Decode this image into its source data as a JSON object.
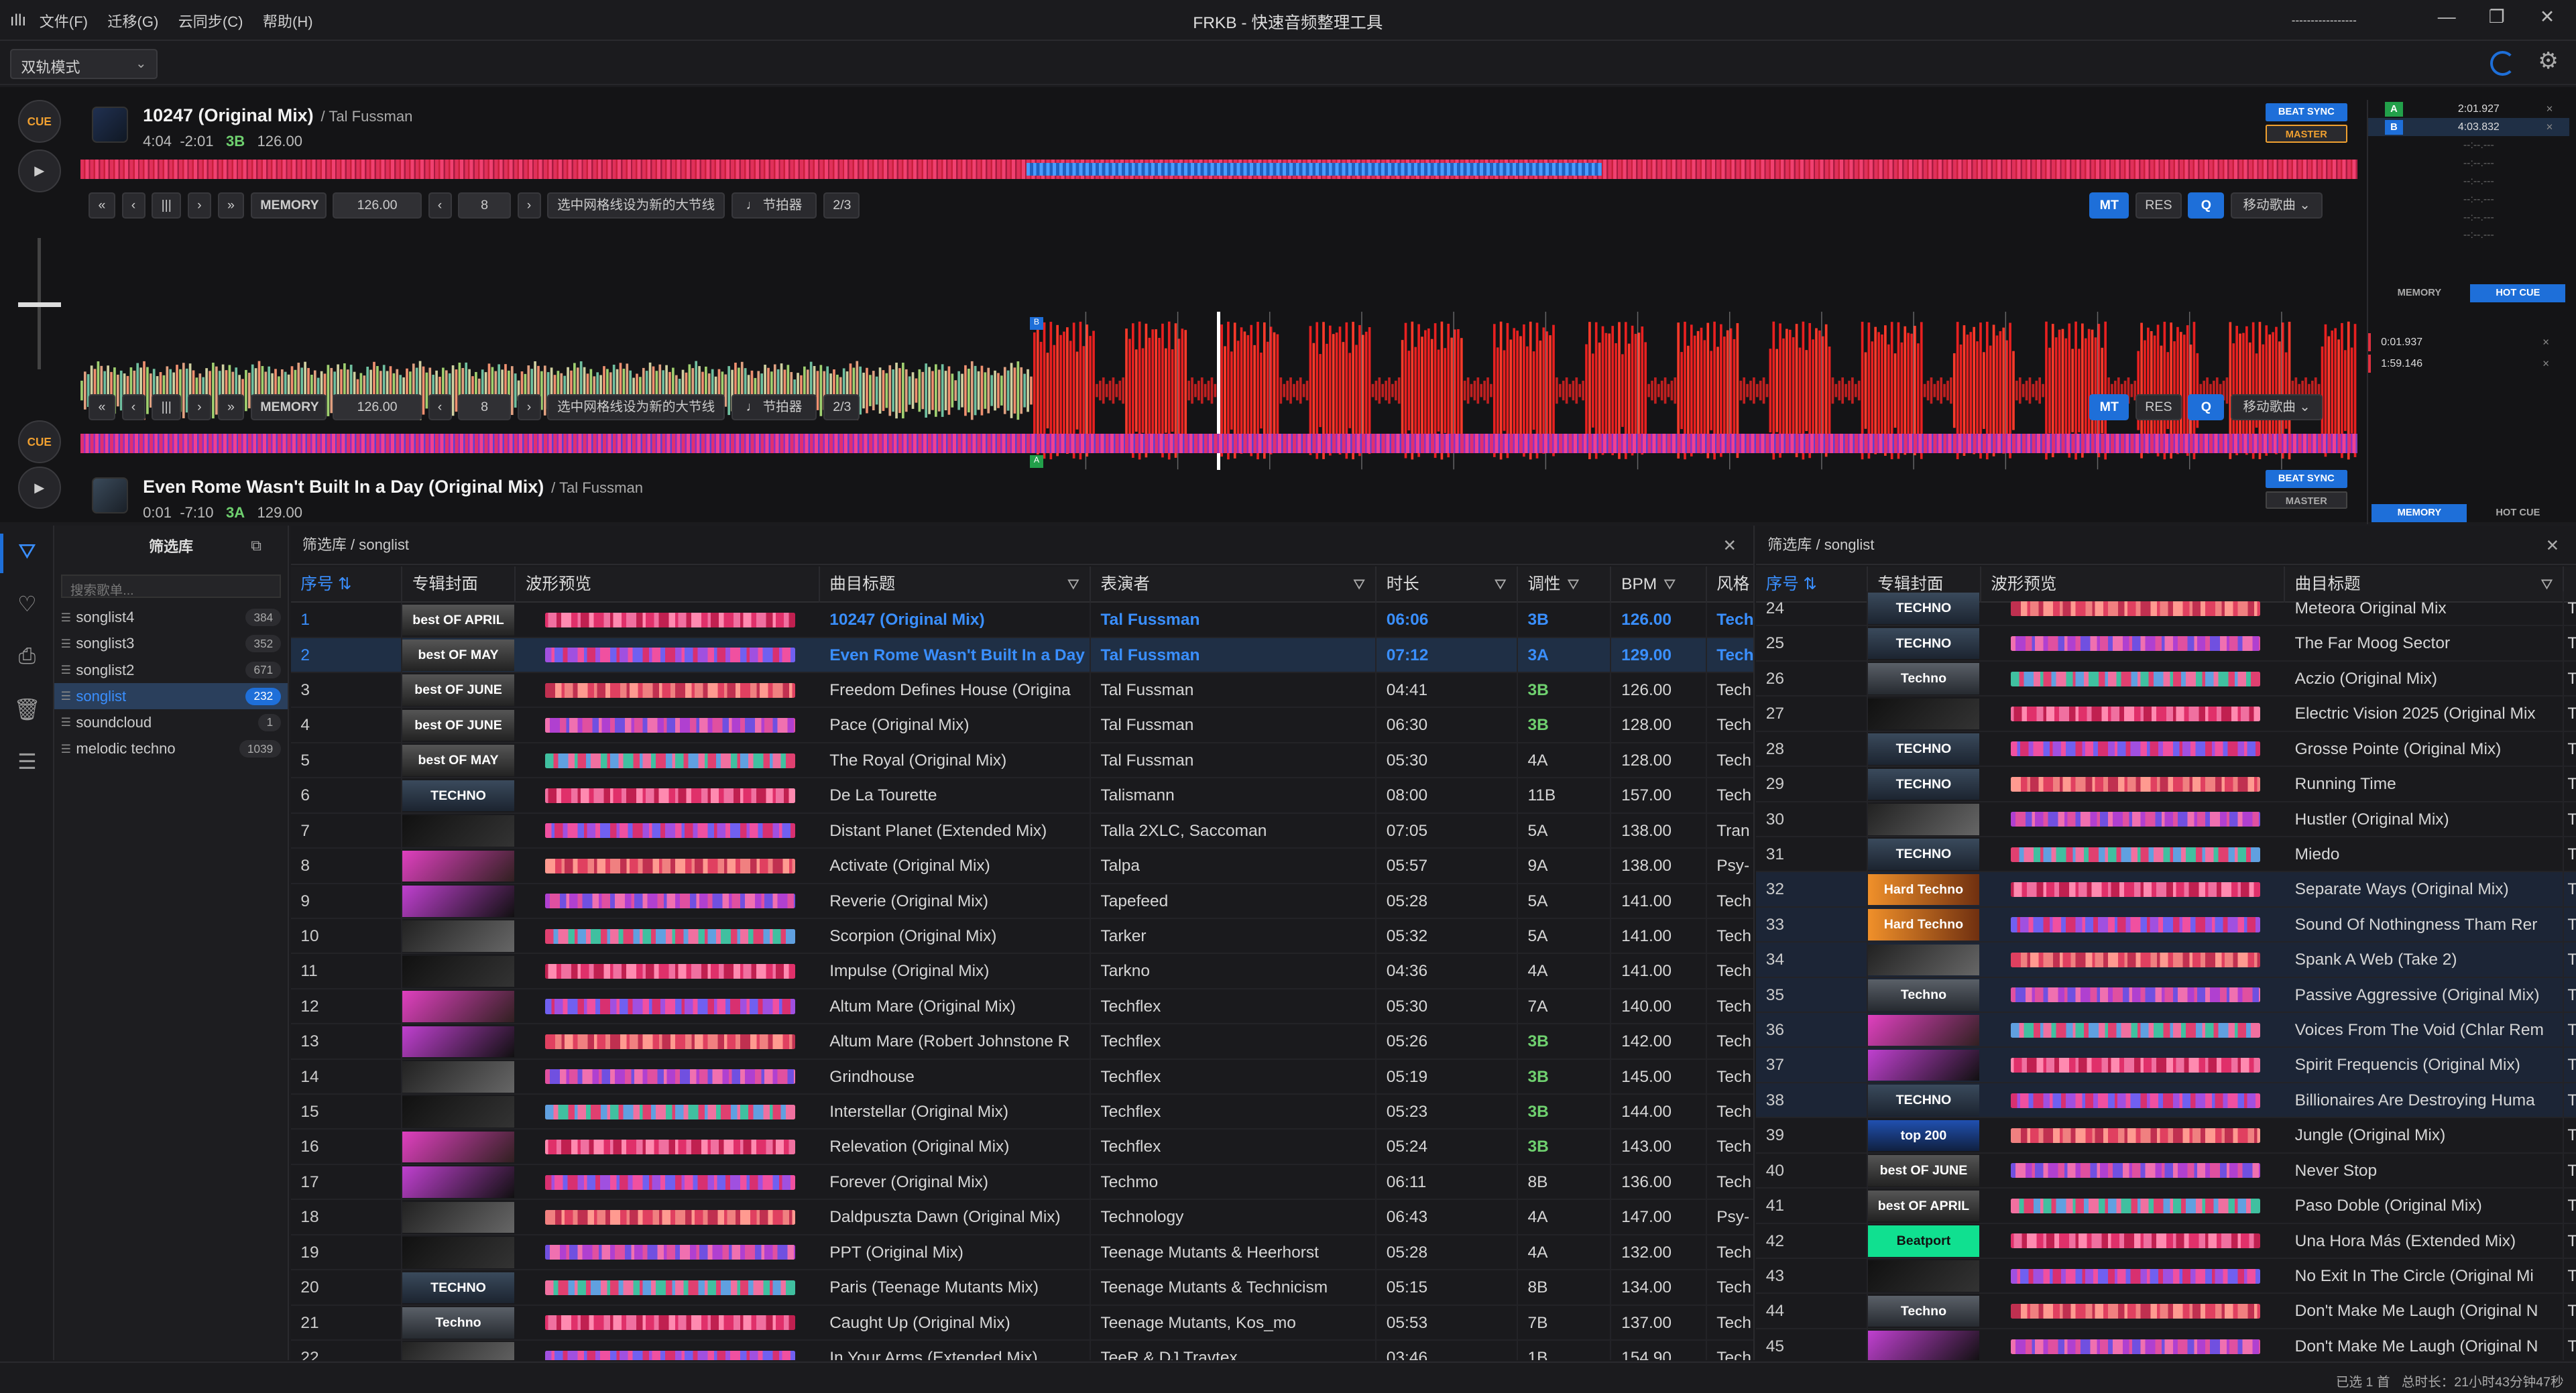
{
  "titlebar": {
    "menu": [
      "文件(F)",
      "迁移(G)",
      "云同步(C)",
      "帮助(H)"
    ],
    "title": "FRKB - 快速音频整理工具",
    "indicator": "-----------------"
  },
  "modebar": {
    "mode": "双轨模式"
  },
  "deck1": {
    "cue_label": "CUE",
    "title": "10247 (Original Mix)",
    "artist": "/ Tal Fussman",
    "time": "4:04",
    "remain": "-2:01",
    "key": "3B",
    "bpm": "126.00",
    "beat_sync": "BEAT SYNC",
    "master": "MASTER"
  },
  "deck2": {
    "cue_label": "CUE",
    "title": "Even Rome Wasn't Built In a Day (Original Mix)",
    "artist": "/ Tal Fussman",
    "time": "0:01",
    "remain": "-7:10",
    "key": "3A",
    "bpm": "129.00",
    "beat_sync": "BEAT SYNC",
    "master": "MASTER"
  },
  "controls": {
    "memory": "MEMORY",
    "bpm": "126.00",
    "beats": "8",
    "grid_label": "选中网格线设为新的大节线",
    "metronome": "节拍器",
    "ratio": "2/3",
    "mt": "MT",
    "res": "RES",
    "q": "Q",
    "move": "移动歌曲"
  },
  "cuepanel": {
    "cues": [
      {
        "tag": "A",
        "time": "2:01.927",
        "color": "#22a04a"
      },
      {
        "tag": "B",
        "time": "4:03.832",
        "color": "#1e6fd9"
      }
    ],
    "empty": "--:--.---",
    "memory_tab": "MEMORY",
    "hotcue_tab": "HOT CUE",
    "mem_cues": [
      "0:01.937",
      "1:59.146"
    ]
  },
  "library": {
    "header": "筛选库",
    "search_placeholder": "搜索歌单...",
    "playlists": [
      {
        "name": "songlist4",
        "count": "384"
      },
      {
        "name": "songlist3",
        "count": "352"
      },
      {
        "name": "songlist2",
        "count": "671"
      },
      {
        "name": "songlist",
        "count": "232",
        "selected": true
      },
      {
        "name": "soundcloud",
        "count": "1"
      },
      {
        "name": "melodic techno",
        "count": "1039"
      }
    ]
  },
  "left_pane": {
    "breadcrumb": "筛选库 / songlist",
    "columns": [
      "序号",
      "专辑封面",
      "波形预览",
      "曲目标题",
      "表演者",
      "时长",
      "调性",
      "BPM",
      "风格"
    ],
    "rows": [
      [
        "1",
        "10247 (Original Mix)",
        "Tal Fussman",
        "06:06",
        "3B",
        "126.00",
        "Tech"
      ],
      [
        "2",
        "Even Rome Wasn't Built In a Day",
        "Tal Fussman",
        "07:12",
        "3A",
        "129.00",
        "Tech"
      ],
      [
        "3",
        "Freedom Defines House (Origina",
        "Tal Fussman",
        "04:41",
        "3B",
        "126.00",
        "Tech"
      ],
      [
        "4",
        "Pace (Original Mix)",
        "Tal Fussman",
        "06:30",
        "3B",
        "128.00",
        "Tech"
      ],
      [
        "5",
        "The Royal (Original Mix)",
        "Tal Fussman",
        "05:30",
        "4A",
        "128.00",
        "Tech"
      ],
      [
        "6",
        "De La Tourette",
        "Talismann",
        "08:00",
        "11B",
        "157.00",
        "Tech"
      ],
      [
        "7",
        "Distant Planet (Extended Mix)",
        "Talla 2XLC, Saccoman",
        "07:05",
        "5A",
        "138.00",
        "Tran"
      ],
      [
        "8",
        "Activate (Original Mix)",
        "Talpa",
        "05:57",
        "9A",
        "138.00",
        "Psy-"
      ],
      [
        "9",
        "Reverie (Original Mix)",
        "Tapefeed",
        "05:28",
        "5A",
        "141.00",
        "Tech"
      ],
      [
        "10",
        "Scorpion (Original Mix)",
        "Tarker",
        "05:32",
        "5A",
        "141.00",
        "Tech"
      ],
      [
        "11",
        "Impulse (Original Mix)",
        "Tarkno",
        "04:36",
        "4A",
        "141.00",
        "Tech"
      ],
      [
        "12",
        "Altum Mare (Original Mix)",
        "Techflex",
        "05:30",
        "7A",
        "140.00",
        "Tech"
      ],
      [
        "13",
        "Altum Mare (Robert Johnstone R",
        "Techflex",
        "05:26",
        "3B",
        "142.00",
        "Tech"
      ],
      [
        "14",
        "Grindhouse",
        "Techflex",
        "05:19",
        "3B",
        "145.00",
        "Tech"
      ],
      [
        "15",
        "Interstellar (Original Mix)",
        "Techflex",
        "05:23",
        "3B",
        "144.00",
        "Tech"
      ],
      [
        "16",
        "Relevation (Original Mix)",
        "Techflex",
        "05:24",
        "3B",
        "143.00",
        "Tech"
      ],
      [
        "17",
        "Forever (Original Mix)",
        "Techmo",
        "06:11",
        "8B",
        "136.00",
        "Tech"
      ],
      [
        "18",
        "Daldpuszta Dawn (Original Mix)",
        "Technology",
        "06:43",
        "4A",
        "147.00",
        "Psy-"
      ],
      [
        "19",
        "PPT (Original Mix)",
        "Teenage Mutants & Heerhorst",
        "05:28",
        "4A",
        "132.00",
        "Tech"
      ],
      [
        "20",
        "Paris (Teenage Mutants Mix)",
        "Teenage Mutants & Technicism",
        "05:15",
        "8B",
        "134.00",
        "Tech"
      ],
      [
        "21",
        "Caught Up (Original Mix)",
        "Teenage Mutants, Kos_mo",
        "05:53",
        "7B",
        "137.00",
        "Tech"
      ],
      [
        "22",
        "In Your Arms (Extended Mix)",
        "TeeR & DJ Travtex",
        "03:46",
        "1B",
        "154.90",
        "Tech"
      ]
    ],
    "covers": [
      "best OF APRIL",
      "best OF MAY",
      "best OF JUNE",
      "best OF JUNE",
      "best OF MAY",
      "TECHNO",
      "",
      "",
      "",
      "",
      "",
      "",
      "",
      "",
      "",
      "",
      "",
      "",
      "",
      "TECHNO",
      "Techno",
      ""
    ]
  },
  "right_pane": {
    "breadcrumb": "筛选库 / songlist",
    "columns": [
      "序号",
      "专辑封面",
      "波形预览",
      "曲目标题"
    ],
    "rows": [
      [
        "24",
        "Meteora Original Mix"
      ],
      [
        "25",
        "The Far Moog Sector"
      ],
      [
        "26",
        "Aczio (Original Mix)"
      ],
      [
        "27",
        "Electric Vision 2025 (Original Mix"
      ],
      [
        "28",
        "Grosse Pointe (Original Mix)"
      ],
      [
        "29",
        "Running Time"
      ],
      [
        "30",
        "Hustler (Original Mix)"
      ],
      [
        "31",
        "Miedo"
      ],
      [
        "32",
        "Separate Ways (Original Mix)"
      ],
      [
        "33",
        "Sound Of Nothingness Tham Rer"
      ],
      [
        "34",
        "Spank A Web (Take 2)"
      ],
      [
        "35",
        "Passive Aggressive (Original Mix)"
      ],
      [
        "36",
        "Voices From The Void (Chlar Rem"
      ],
      [
        "37",
        "Spirit Frequencis (Original Mix)"
      ],
      [
        "38",
        "Billionaires Are Destroying Huma"
      ],
      [
        "39",
        "Jungle (Original Mix)"
      ],
      [
        "40",
        "Never Stop"
      ],
      [
        "41",
        "Paso Doble (Original Mix)"
      ],
      [
        "42",
        "Una Hora Más (Extended Mix)"
      ],
      [
        "43",
        "No Exit In The Circle (Original Mi"
      ],
      [
        "44",
        "Don't Make Me Laugh (Original N"
      ],
      [
        "45",
        "Don't Make Me Laugh (Original N"
      ]
    ],
    "covers": [
      "TECHNO",
      "TECHNO",
      "Techno",
      "",
      "TECHNO",
      "TECHNO",
      "",
      "TECHNO",
      "Hard Techno",
      "Hard Techno",
      "",
      "Techno",
      "",
      "",
      "TECHNO",
      "top 200",
      "best OF JUNE",
      "best OF APRIL",
      "Beatport",
      "",
      "Techno",
      ""
    ]
  },
  "status": {
    "selected": "已选 1 首",
    "total": "总时长：21小时43分钟47秒"
  }
}
